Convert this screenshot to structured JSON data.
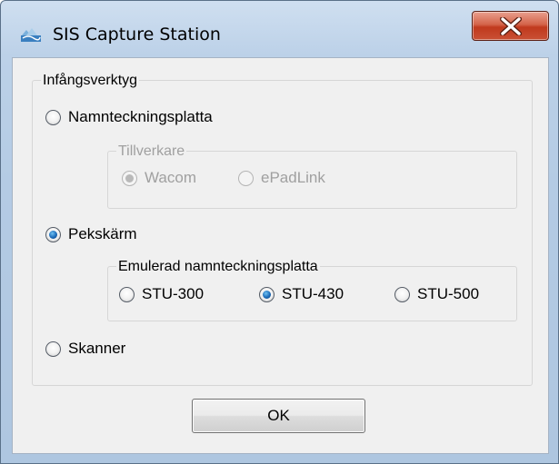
{
  "window": {
    "title": "SIS Capture Station",
    "app_icon": "sis-capture-icon",
    "close_icon": "close-icon"
  },
  "capture_tool": {
    "legend": "Infångsverktyg",
    "options": {
      "signature_pad": {
        "label": "Namnteckningsplatta",
        "checked": false
      },
      "touchscreen": {
        "label": "Pekskärm",
        "checked": true
      },
      "scanner": {
        "label": "Skanner",
        "checked": false
      }
    }
  },
  "manufacturer": {
    "legend": "Tillverkare",
    "enabled": false,
    "options": {
      "wacom": {
        "label": "Wacom",
        "checked": true
      },
      "epadlink": {
        "label": "ePadLink",
        "checked": false
      }
    }
  },
  "emulated_pad": {
    "legend": "Emulerad namnteckningsplatta",
    "options": {
      "stu300": {
        "label": "STU-300",
        "checked": false
      },
      "stu430": {
        "label": "STU-430",
        "checked": true
      },
      "stu500": {
        "label": "STU-500",
        "checked": false
      }
    }
  },
  "ok_button": {
    "label": "OK"
  },
  "colors": {
    "accent_radio": "#1b6ab8",
    "close_button": "#c0391d",
    "dialog_background": "#f0f0f0",
    "window_frame": "#b4cbe4"
  }
}
